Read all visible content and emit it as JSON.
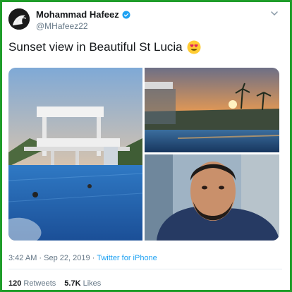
{
  "author": {
    "name": "Mohammad Hafeez",
    "handle": "@MHafeez22",
    "verified": true,
    "avatar_icon": "avatar-photo"
  },
  "tweet": {
    "text": "Sunset view in Beautiful St Lucia",
    "emoji": "heart-eyes-emoji"
  },
  "media": {
    "images": [
      "pool-tower-photo",
      "sunset-palms-photo",
      "selfie-photo"
    ]
  },
  "meta": {
    "time": "3:42 AM",
    "sep1": "·",
    "date": "Sep 22, 2019",
    "sep2": "·",
    "source": "Twitter for iPhone"
  },
  "stats": {
    "retweets_count": "120",
    "retweets_label": "Retweets",
    "likes_count": "5.7K",
    "likes_label": "Likes"
  },
  "colors": {
    "frame": "#1f9d2a",
    "link": "#1da1f2",
    "muted": "#657786",
    "text": "#14171a"
  }
}
